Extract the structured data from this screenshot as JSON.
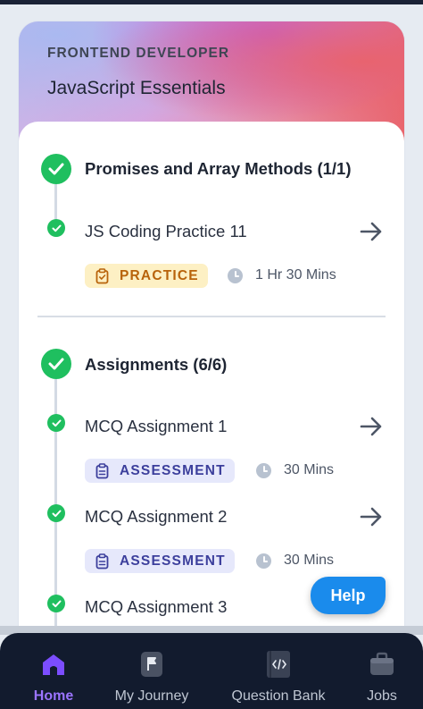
{
  "course": {
    "track": "FRONTEND DEVELOPER",
    "title": "JavaScript Essentials"
  },
  "sections": [
    {
      "title": "Promises and Array Methods (1/1)",
      "items": [
        {
          "title": "JS Coding Practice 11",
          "tag": "PRACTICE",
          "duration": "1 Hr 30 Mins"
        }
      ]
    },
    {
      "title": "Assignments (6/6)",
      "items": [
        {
          "title": "MCQ Assignment 1",
          "tag": "ASSESSMENT",
          "duration": "30 Mins"
        },
        {
          "title": "MCQ Assignment 2",
          "tag": "ASSESSMENT",
          "duration": "30 Mins"
        },
        {
          "title": "MCQ Assignment 3"
        }
      ]
    }
  ],
  "help_label": "Help",
  "nav": [
    {
      "label": "Home",
      "icon": "home-icon",
      "active": true
    },
    {
      "label": "My Journey",
      "icon": "flag-icon"
    },
    {
      "label": "Question Bank",
      "icon": "code-book-icon"
    },
    {
      "label": "Jobs",
      "icon": "briefcase-icon"
    }
  ],
  "colors": {
    "success": "#1fbf5f",
    "practice_bg": "#fdf0c4",
    "practice_text": "#b8630b",
    "assessment_bg": "#e6e8fb",
    "assessment_text": "#3c3f9c",
    "help_button": "#1a8bec",
    "nav_bg": "#121b2e",
    "nav_active": "#9b74ff"
  }
}
